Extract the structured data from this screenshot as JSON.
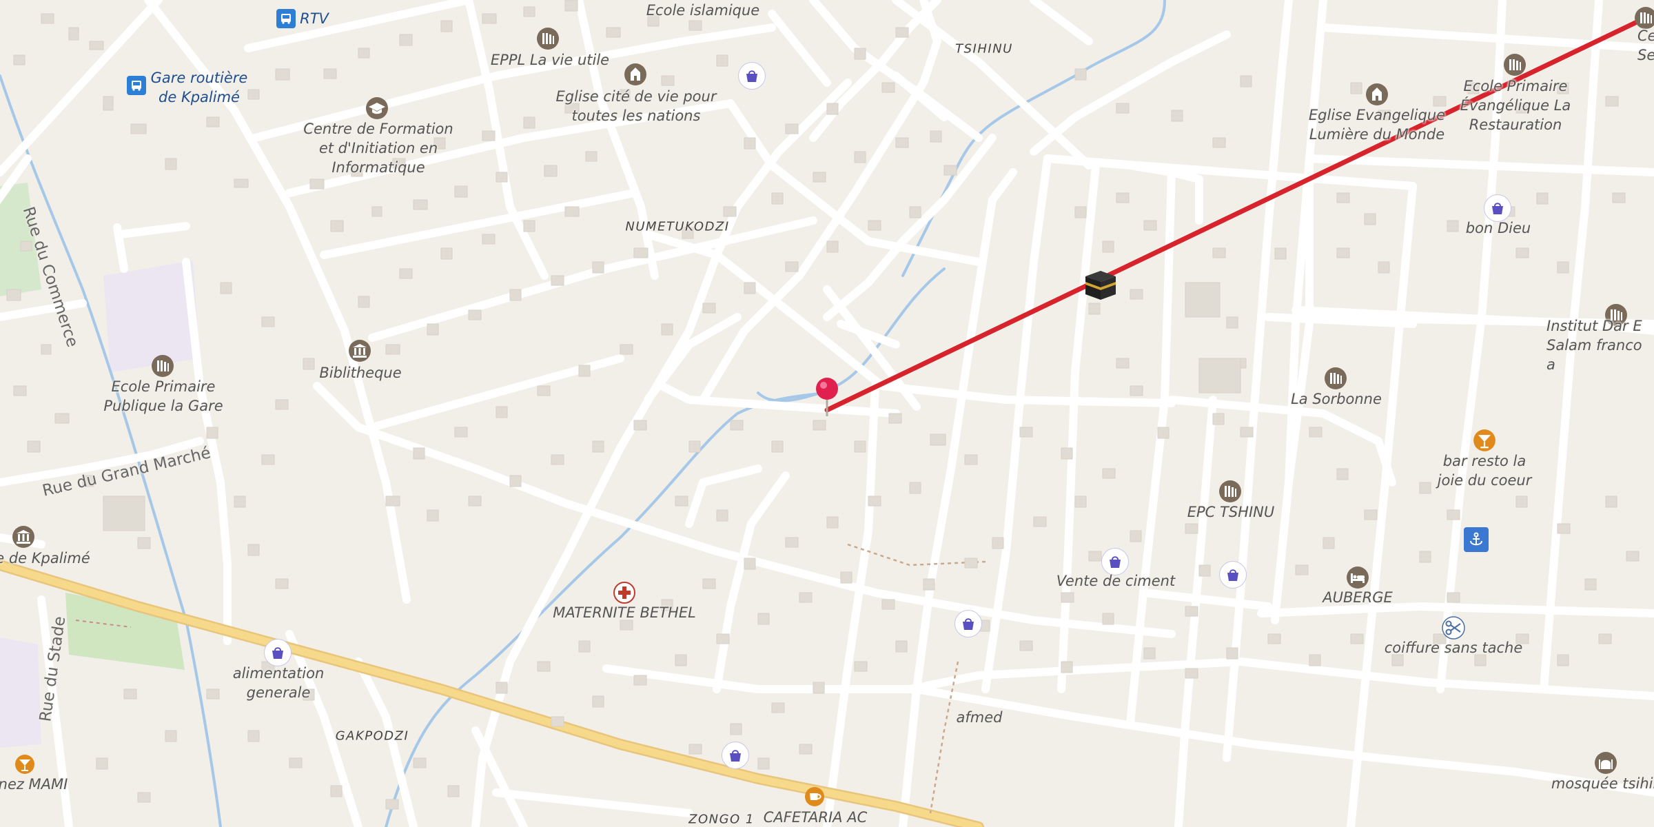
{
  "map": {
    "colors": {
      "background": "#f2efe9",
      "road": "#ffffff",
      "primary_road": "#f7d98c",
      "water": "#a6c8e8",
      "building": "#e0dbd3",
      "route": "#d6232c",
      "pin": "#e0204f",
      "park": "#c9e3b9"
    },
    "bus_labels": [
      {
        "id": "rtv",
        "text": "RTV"
      },
      {
        "id": "gare",
        "text": "Gare routière\nde Kpalimé"
      }
    ],
    "area_labels": [
      {
        "id": "tsihinu",
        "text": "TSIHINU"
      },
      {
        "id": "numetukodzi",
        "text": "NUMETUKODZI"
      },
      {
        "id": "gakpodzi",
        "text": "GAKPODZI"
      },
      {
        "id": "zongo",
        "text": "ZONGO 1"
      }
    ],
    "street_labels": [
      {
        "id": "rue-commerce",
        "text": "Rue du Commerce"
      },
      {
        "id": "rue-grand-marche",
        "text": "Rue du Grand Marché"
      },
      {
        "id": "rue-stade",
        "text": "Rue du Stade"
      }
    ],
    "poi_labels": [
      {
        "id": "ecole-islamique",
        "text": "Ecole islamique"
      },
      {
        "id": "eppl",
        "text": "EPPL La vie utile"
      },
      {
        "id": "eglise-cite",
        "text": "Eglise cité de vie pour\ntoutes les nations"
      },
      {
        "id": "centre-formation",
        "text": "Centre de Formation\net d'Initiation en\nInformatique"
      },
      {
        "id": "biblitheque",
        "text": "Biblitheque"
      },
      {
        "id": "ecole-gare",
        "text": "Ecole Primaire\nPublique la Gare"
      },
      {
        "id": "kpalime-left",
        "text": "e de Kpalimé"
      },
      {
        "id": "alimentation",
        "text": "alimentation\ngenerale"
      },
      {
        "id": "maternite",
        "text": "MATERNITE BETHEL"
      },
      {
        "id": "chez-mami",
        "text": "nez MAMI"
      },
      {
        "id": "cafetaria",
        "text": "CAFETARIA AC"
      },
      {
        "id": "afmed",
        "text": "afmed"
      },
      {
        "id": "vente-ciment",
        "text": "Vente de ciment"
      },
      {
        "id": "epc-tshinu",
        "text": "EPC TSHINU"
      },
      {
        "id": "la-sorbonne",
        "text": "La Sorbonne"
      },
      {
        "id": "eglise-evang",
        "text": "Eglise Evangelique\nLumière du Monde"
      },
      {
        "id": "ecole-evang",
        "text": "Ecole Primaire\nÉvangélique La\nRestauration"
      },
      {
        "id": "centre-seigneur",
        "text": "Centre\nSeigneur"
      },
      {
        "id": "bon-dieu",
        "text": "bon Dieu"
      },
      {
        "id": "institut",
        "text": "Institut Dar E\nSalam franco a"
      },
      {
        "id": "bar-resto",
        "text": "bar resto la\njoie du coeur"
      },
      {
        "id": "auberge",
        "text": "AUBERGE"
      },
      {
        "id": "coiffure",
        "text": "coiffure sans tache"
      },
      {
        "id": "mosquee",
        "text": "mosquée tsihinu"
      }
    ],
    "icons": [
      "bus-icon",
      "school-icon",
      "church-icon",
      "shopping-bag-icon",
      "graduation-cap-icon",
      "library-icon",
      "museum-icon",
      "hospital-cross-icon",
      "cocktail-icon",
      "coffee-cup-icon",
      "bed-icon",
      "scissors-icon",
      "anchor-icon",
      "mosque-icon",
      "kaaba-icon",
      "location-pin-icon"
    ]
  }
}
